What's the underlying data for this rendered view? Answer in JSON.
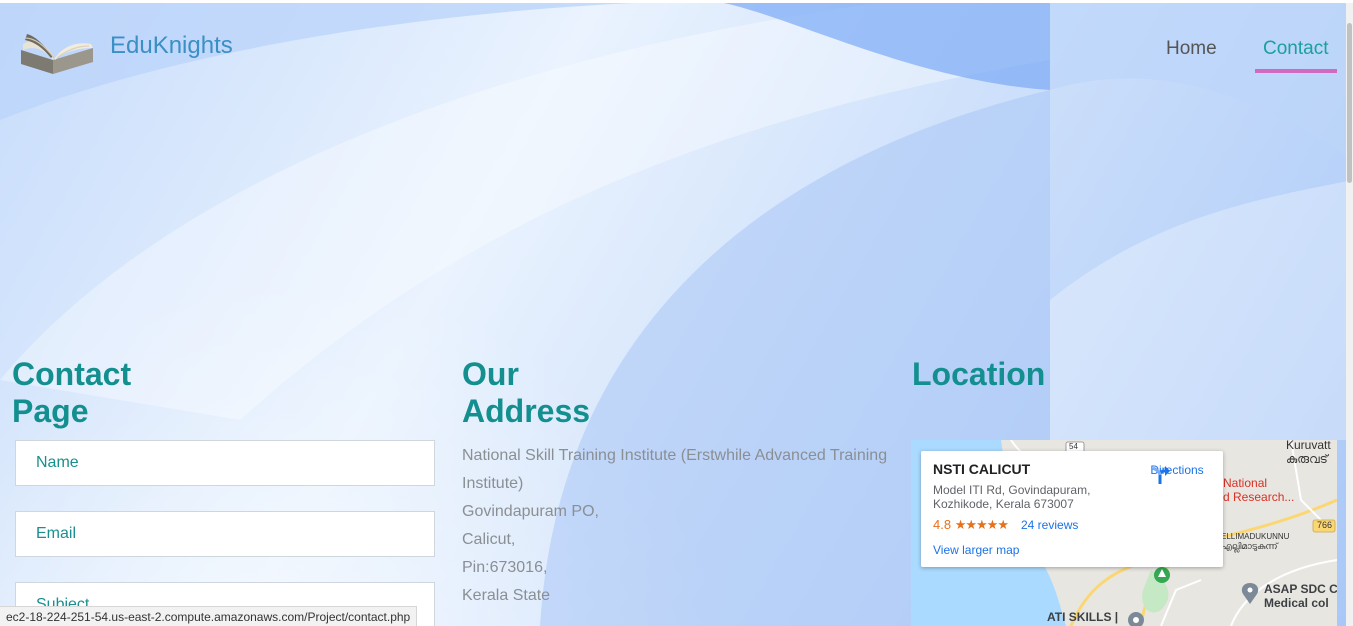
{
  "header": {
    "brand": "EduKnights",
    "nav": [
      {
        "label": "Home"
      },
      {
        "label": "Contact"
      }
    ],
    "active_nav": "Contact"
  },
  "contact": {
    "title": "Contact Page",
    "fields": {
      "name_placeholder": "Name",
      "email_placeholder": "Email",
      "subject_placeholder": "Subject"
    }
  },
  "address": {
    "title": "Our Address",
    "lines": [
      "National Skill Training Institute (Erstwhile Advanced Training Institute)",
      "Govindapuram PO,",
      "Calicut,",
      "Pin:673016,",
      "Kerala State"
    ]
  },
  "location": {
    "title": "Location",
    "card": {
      "place_name": "NSTI CALICUT",
      "address_line1": "Model ITI Rd, Govindapuram,",
      "address_line2": "Kozhikode, Kerala 673007",
      "rating": "4.8",
      "stars": "★★★★★",
      "reviews": "24 reviews",
      "directions": "Directions",
      "larger_map": "View larger map"
    },
    "labels": {
      "kuruvatt": "Kuruvatt",
      "kuruvatt_ml": "കുരുവട്",
      "national": "National",
      "research": "d Research...",
      "ellimadukunnu": "ELLIMADUKUNNU",
      "ellimadukunnu_ml": "എല്ലിമാടുകുന്ന്",
      "road_766": "766",
      "road_54": "54",
      "asap": "ASAP SDC C",
      "medical": "Medical col",
      "ati": "ATI SKILLS |"
    }
  },
  "statusbar": {
    "url": "ec2-18-224-251-54.us-east-2.compute.amazonaws.com/Project/contact.php"
  },
  "colors": {
    "heading": "#148f8f",
    "brand": "#3a8fc4",
    "nav_active": "#1aa0a0",
    "nav_underline": "#d06ac0"
  }
}
